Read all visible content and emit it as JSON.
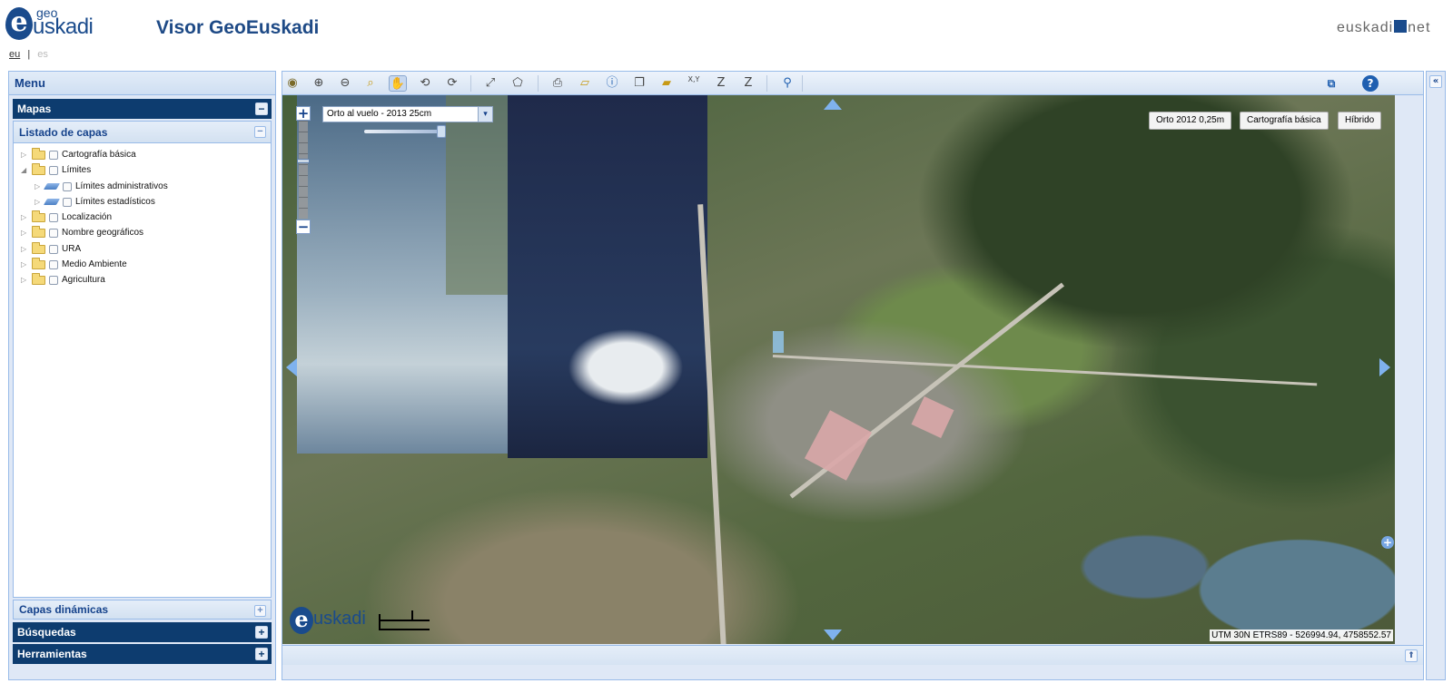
{
  "header": {
    "logo": {
      "prefix": "e",
      "geo": "geo",
      "brand": "uskadi"
    },
    "title": "Visor GeoEuskadi",
    "lang": {
      "eu": "eu",
      "separator": "|",
      "es": "es"
    },
    "partner_logo": {
      "left": "euskadi",
      "right": "net"
    }
  },
  "sidebar": {
    "menu_title": "Menu",
    "mapas": {
      "label": "Mapas",
      "toggle": "−"
    },
    "capas": {
      "title": "Listado de capas",
      "toggle": "−",
      "items": [
        {
          "label": "Cartografía básica",
          "expanded": false,
          "icon": "folder-icon",
          "level": 0
        },
        {
          "label": "Límites",
          "expanded": true,
          "icon": "folder-icon",
          "level": 0
        },
        {
          "label": "Límites administrativos",
          "expanded": false,
          "icon": "layer-icon",
          "level": 1
        },
        {
          "label": "Límites estadísticos",
          "expanded": false,
          "icon": "layer-icon",
          "level": 1
        },
        {
          "label": "Localización",
          "expanded": false,
          "icon": "folder-icon",
          "level": 0
        },
        {
          "label": "Nombre geográficos",
          "expanded": false,
          "icon": "folder-icon",
          "level": 0
        },
        {
          "label": "URA",
          "expanded": false,
          "icon": "folder-icon",
          "level": 0
        },
        {
          "label": "Medio Ambiente",
          "expanded": false,
          "icon": "folder-icon",
          "level": 0
        },
        {
          "label": "Agricultura",
          "expanded": false,
          "icon": "folder-icon",
          "level": 0
        }
      ]
    },
    "capas_dinamicas": {
      "label": "Capas dinámicas",
      "toggle": "+"
    },
    "busquedas": {
      "label": "Búsquedas",
      "toggle": "+"
    },
    "herramientas": {
      "label": "Herramientas",
      "toggle": "+"
    }
  },
  "toolbar": {
    "icons": [
      {
        "name": "full-extent-icon",
        "glyph": "◉"
      },
      {
        "name": "zoom-in-icon",
        "glyph": "⊕"
      },
      {
        "name": "zoom-out-icon",
        "glyph": "⊖"
      },
      {
        "name": "zoom-box-icon",
        "glyph": "⌕"
      },
      {
        "name": "pan-hand-icon",
        "glyph": "✋"
      },
      {
        "name": "zoom-previous-icon",
        "glyph": "⟲"
      },
      {
        "name": "zoom-next-icon",
        "glyph": "⟳"
      },
      {
        "name": "measure-distance-icon",
        "glyph": "⤢"
      },
      {
        "name": "measure-area-icon",
        "glyph": "⬠"
      },
      {
        "name": "print-icon",
        "glyph": "⎙"
      },
      {
        "name": "export-icon",
        "glyph": "▱"
      },
      {
        "name": "info-icon",
        "glyph": "ⓘ"
      },
      {
        "name": "copy-icon",
        "glyph": "❐"
      },
      {
        "name": "eraser-icon",
        "glyph": "▰"
      },
      {
        "name": "coordinates-xy-icon",
        "glyph": "X,Y"
      },
      {
        "name": "elevation-z-icon",
        "glyph": "Z"
      },
      {
        "name": "profile-z-icon",
        "glyph": "Z"
      },
      {
        "name": "location-pin-icon",
        "glyph": "⚲"
      }
    ],
    "right_icons": [
      {
        "name": "new-window-icon",
        "glyph": "⧉"
      },
      {
        "name": "help-icon",
        "glyph": "?"
      }
    ]
  },
  "map": {
    "layer_select": {
      "value": "Orto al vuelo - 2013 25cm",
      "arrow": "▾"
    },
    "opacity_level": 1.0,
    "zoom": {
      "plus": "+",
      "minus": "−"
    },
    "base_layers": [
      "Orto 2012 0,25m",
      "Cartografía básica",
      "Híbrido"
    ],
    "plus_marker": "+",
    "coordinates": "UTM 30N ETRS89 - 526994.94, 4758552.57",
    "logo": {
      "prefix": "e",
      "brand": "uskadi"
    },
    "colors": {
      "water_dark": "#1f2a4a",
      "forest": "#2f4226",
      "industry": "#d9a7a9"
    }
  },
  "status_bar": {
    "toggle": "⇑"
  },
  "right_panel": {
    "toggle": "«"
  }
}
